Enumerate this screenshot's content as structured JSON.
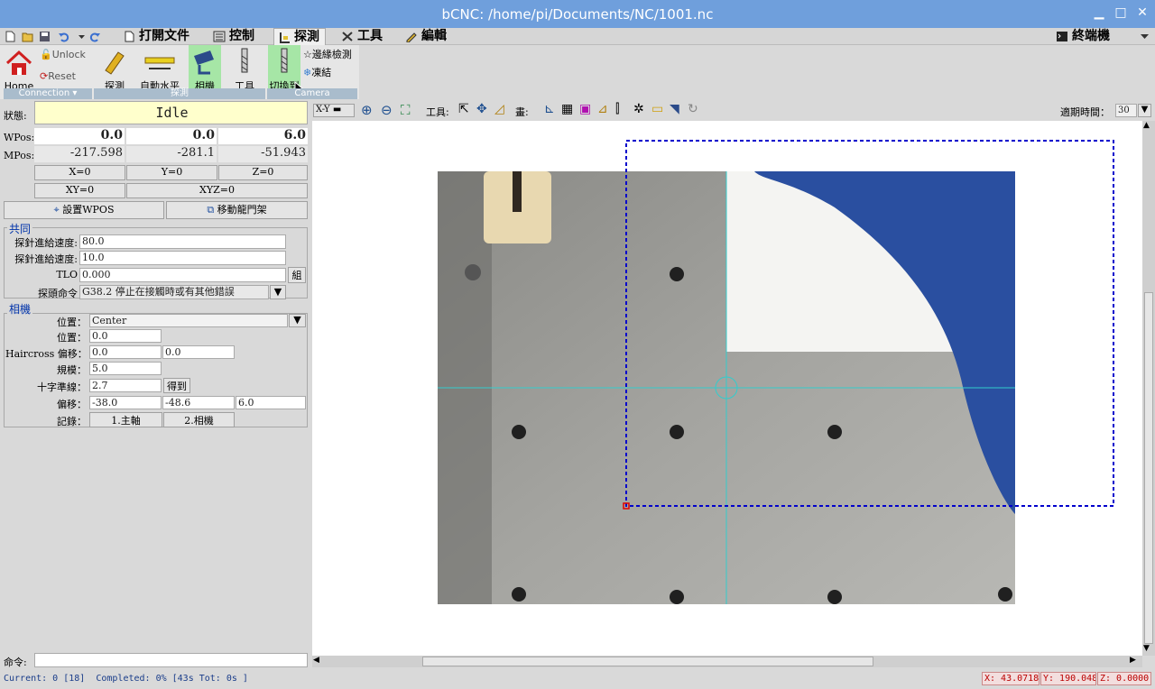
{
  "window": {
    "title": "bCNC: /home/pi/Documents/NC/1001.nc"
  },
  "menu": {
    "tabs": [
      {
        "label": "打開文件",
        "icon": "file-icon"
      },
      {
        "label": "控制",
        "icon": "control-icon"
      },
      {
        "label": "探測",
        "icon": "probe-icon"
      },
      {
        "label": "工具",
        "icon": "tools-icon"
      },
      {
        "label": "編輯",
        "icon": "edit-icon"
      }
    ],
    "active_tab": "探測",
    "terminal_label": "終端機"
  },
  "ribbon": {
    "home_label": "Home",
    "unlock_label": "Unlock",
    "reset_label": "Reset",
    "connection_label": "Connection",
    "probe_label": "探測",
    "autolevel_label": "自動水平",
    "camera_label": "相機",
    "tool_label": "工具",
    "tooltip_label": "切換到",
    "edge_label": "邊緣檢測",
    "freeze_label": "凍結",
    "group_probe_label": "探測",
    "group_camera_label": "Camera"
  },
  "dro": {
    "state_label": "狀態:",
    "state": "Idle",
    "wpos_label": "WPos:",
    "wpos": [
      "0.0",
      "0.0",
      "6.0"
    ],
    "mpos_label": "MPos:",
    "mpos": [
      "-217.598",
      "-281.1",
      "-51.943"
    ],
    "zero_buttons": [
      "X=0",
      "Y=0",
      "Z=0"
    ],
    "xy_zero": "XY=0",
    "xyz_zero": "XYZ=0",
    "set_wpos": "設置WPOS",
    "move_gantry": "移動龍門架"
  },
  "common": {
    "title": "共同",
    "fast_feed_label": "探針進給速度:",
    "fast_feed": "80.0",
    "feed_label": "探針進給速度:",
    "feed": "10.0",
    "tlo_label": "TLO",
    "tlo": "0.000",
    "tlo_button": "組",
    "cmd_label": "探頭命令",
    "cmd": "G38.2 停止在接觸時或有其他錯誤"
  },
  "camera": {
    "title": "相機",
    "location_label": "位置：",
    "location": "Center",
    "rotation_label": "位置：",
    "rotation": "0.0",
    "haircross_label": "Haircross 偏移：",
    "haircross": [
      "0.0",
      "0.0"
    ],
    "scale_label": "規模：",
    "scale": "5.0",
    "crosshair_label": "十字準線：",
    "crosshair": "2.7",
    "get_button": "得到",
    "offset_label": "偏移：",
    "offset": [
      "-38.0",
      "-48.6",
      "6.0"
    ],
    "register_label": "記錄：",
    "register_buttons": [
      "1.主軸",
      "2.相機"
    ]
  },
  "command": {
    "label": "命令:",
    "value": ""
  },
  "canvas_toolbar": {
    "view": "X-Y",
    "tools_label": "工具:",
    "draw_label": "畫:",
    "timer_label": "適期時間：",
    "timer": "30"
  },
  "status": {
    "text": "Current: 0 [18]  Completed: 0% [43s Tot: 0s ]",
    "x": "X: 43.0718",
    "y": "Y: 190.048",
    "z": "Z: 0.0000"
  },
  "colors": {
    "title_bar": "#6f9fdc",
    "idle_bg": "#ffffcc",
    "group_title": "#0033aa",
    "margin_box": "#0000cc",
    "crosshair": "#33cccc"
  }
}
